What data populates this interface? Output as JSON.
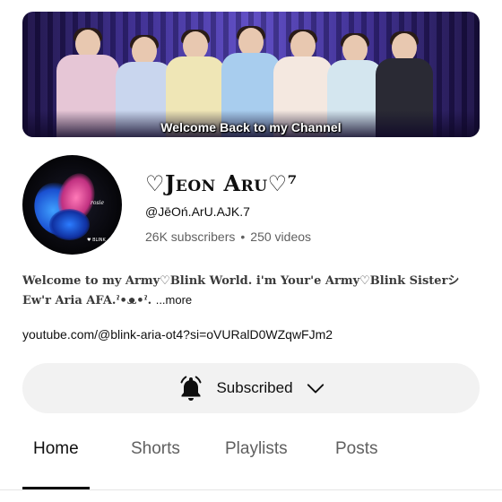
{
  "banner": {
    "text": "Welcome Back to my Channel"
  },
  "channel": {
    "name": "♡Jeon Aru♡⁷",
    "handle": "@JēOń.ArU.AJK.7",
    "subscribers": "26K subscribers",
    "separator": "•",
    "videos": "250 videos"
  },
  "description": {
    "text": "Welcome to my Army♡Blink World. i'm Your'e Army♡Blink Sisterシ Ew'r Aria AFA.ˀ•ᴥ•ˀ.",
    "more": "...more"
  },
  "link": {
    "text": "youtube.com/@blink-aria-ot4?si=oVURalD0WZqwFJm2"
  },
  "subscribe": {
    "label": "Subscribed",
    "bell_icon": "bell-ringing-icon",
    "chevron_icon": "chevron-down-icon"
  },
  "tabs": [
    {
      "label": "Home",
      "active": true
    },
    {
      "label": "Shorts",
      "active": false
    },
    {
      "label": "Playlists",
      "active": false
    },
    {
      "label": "Posts",
      "active": false
    }
  ],
  "colors": {
    "text": "#0f0f0f",
    "secondary": "#606060",
    "button_bg": "#f2f2f2"
  }
}
